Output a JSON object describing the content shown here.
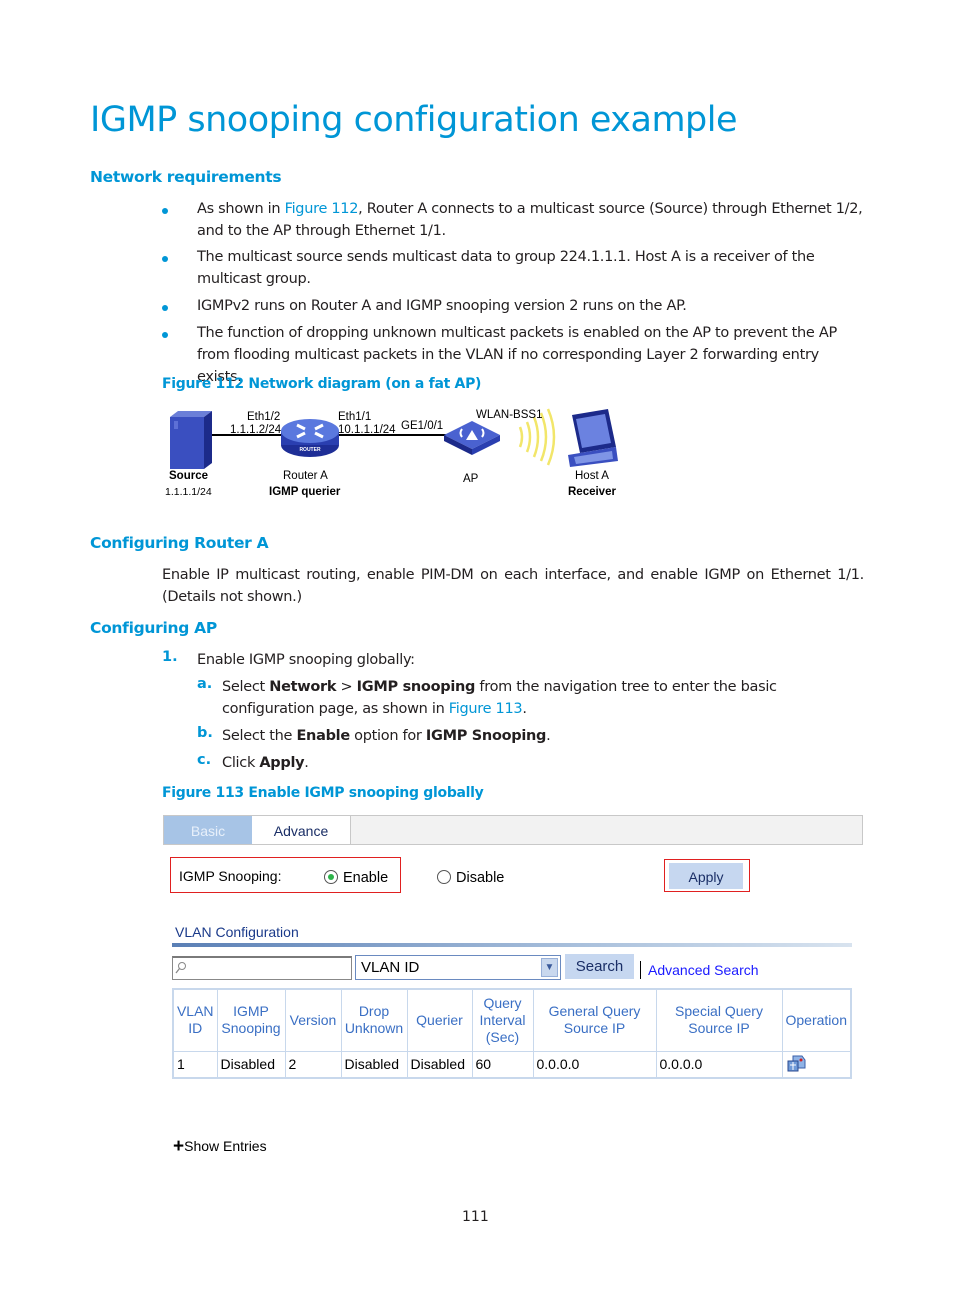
{
  "title": "IGMP snooping configuration example",
  "sections": {
    "network_requirements": "Network requirements",
    "configuring_router": "Configuring Router A",
    "configuring_ap": "Configuring AP"
  },
  "bullets": [
    {
      "pre": "As shown in ",
      "link": "Figure 112",
      "post": ", Router A connects to a multicast source (Source) through Ethernet 1/2, and to the AP through Ethernet 1/1."
    },
    {
      "text": "The multicast source sends multicast data to group 224.1.1.1. Host A is a receiver of the multicast group."
    },
    {
      "text": "IGMPv2 runs on Router A and IGMP snooping version 2 runs on the AP."
    },
    {
      "text": "The function of dropping unknown multicast packets is enabled on the AP to prevent the AP from flooding multicast packets in the VLAN if no corresponding Layer 2 forwarding entry exists."
    }
  ],
  "figure112": {
    "caption": "Figure 112 Network diagram (on a fat AP)",
    "labels": {
      "eth12": "Eth1/2",
      "eth12_ip": "1.1.1.2/24",
      "eth11": "Eth1/1",
      "eth11_ip": "10.1.1.1/24",
      "ge": "GE1/0/1",
      "wlan": "WLAN-BSS1",
      "source": "Source",
      "source_ip": "1.1.1.1/24",
      "router": "Router A",
      "router_role": "IGMP querier",
      "router_badge": "ROUTER",
      "ap": "AP",
      "host": "Host A",
      "host_role": "Receiver"
    }
  },
  "router_text": "Enable IP multicast routing, enable PIM-DM on each interface, and enable IGMP on Ethernet 1/1. (Details not shown.)",
  "steps": {
    "step1_num": "1.",
    "step1": "Enable IGMP snooping globally:",
    "a_num": "a.",
    "a_pre": "Select ",
    "a_b1": "Network",
    "a_mid1": " > ",
    "a_b2": "IGMP snooping",
    "a_mid2": " from the navigation tree to enter the basic configuration page, as shown in ",
    "a_link": "Figure 113",
    "a_post": ".",
    "b_num": "b.",
    "b_pre": "Select the ",
    "b_b1": "Enable",
    "b_mid": " option for ",
    "b_b2": "IGMP Snooping",
    "b_post": ".",
    "c_num": "c.",
    "c_pre": "Click ",
    "c_b": "Apply",
    "c_post": "."
  },
  "figure113": {
    "caption": "Figure 113 Enable IGMP snooping globally",
    "tabs": [
      {
        "label": "Basic",
        "active": true
      },
      {
        "label": "Advance",
        "active": false
      }
    ],
    "igmp_label": "IGMP Snooping:",
    "enable_label": "Enable",
    "disable_label": "Disable",
    "selected": "Enable",
    "apply_label": "Apply",
    "vlan_section": "VLAN Configuration",
    "search_value": "",
    "select_value": "VLAN ID",
    "search_label": "Search",
    "advanced_search": "Advanced Search",
    "columns": [
      "VLAN ID",
      "IGMP Snooping",
      "Version",
      "Drop Unknown",
      "Querier",
      "Query Interval (Sec)",
      "General Query Source IP",
      "Special Query Source IP",
      "Operation"
    ],
    "rows": [
      [
        "1",
        "Disabled",
        "2",
        "Disabled",
        "Disabled",
        "60",
        "0.0.0.0",
        "0.0.0.0",
        "edit-icon"
      ]
    ],
    "show_entries": "Show Entries"
  },
  "colors": {
    "accent": "#0096d6",
    "red_highlight": "#e02020",
    "ui_header": "#3a6fc4"
  },
  "page_number": "111"
}
